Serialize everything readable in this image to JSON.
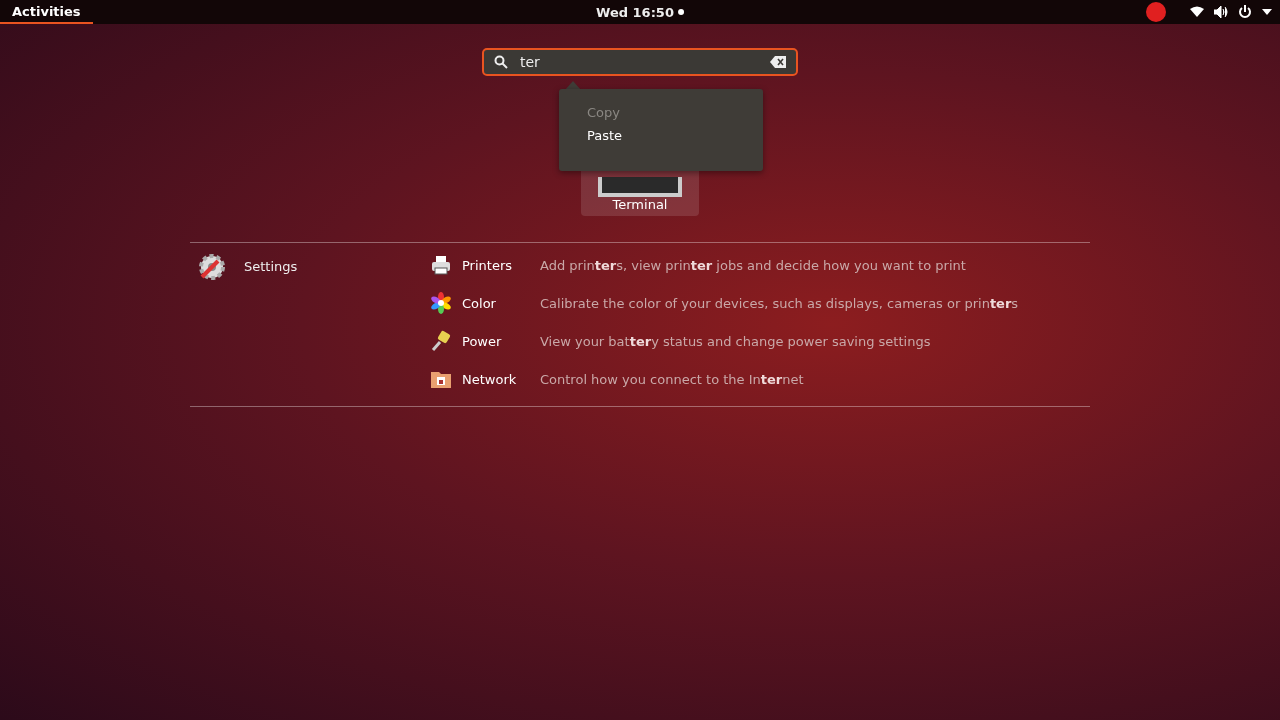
{
  "top_bar": {
    "activities": {
      "label": "Activities",
      "selected": true
    },
    "clock": "Wed 16:50",
    "notification_dot": true
  },
  "search": {
    "value": "ter"
  },
  "context_menu": {
    "items": [
      {
        "label": "Copy",
        "disabled": true
      },
      {
        "label": "Paste",
        "disabled": false
      }
    ]
  },
  "app_results": [
    {
      "label": "Terminal",
      "selected": true
    }
  ],
  "settings_results": {
    "provider": "Settings",
    "items": [
      {
        "name": "Printers",
        "kind": "printer",
        "description": "Add prin**ter**s, view prin**ter** jobs and decide how you want to print"
      },
      {
        "name": "Color",
        "kind": "color",
        "description": "Calibrate the color of your devices, such as displays, cameras or prin**ter**s"
      },
      {
        "name": "Power",
        "kind": "power",
        "description": "View your bat**ter**y status and change power saving settings"
      },
      {
        "name": "Network",
        "kind": "network",
        "description": "Control how you connect to the In**ter**net"
      }
    ]
  }
}
